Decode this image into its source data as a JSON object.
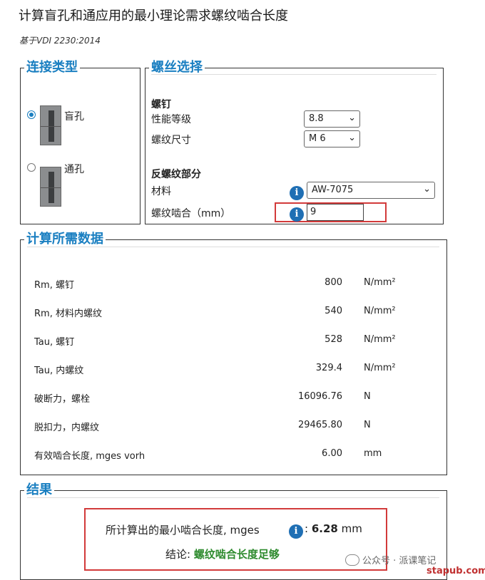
{
  "header": {
    "title": "计算盲孔和通应用的最小理论需求螺纹啮合长度",
    "subtitle": "基于VDI 2230:2014"
  },
  "connection": {
    "legend": "连接类型",
    "options": [
      {
        "label": "盲孔",
        "selected": true
      },
      {
        "label": "通孔",
        "selected": false
      }
    ]
  },
  "screw_selection": {
    "legend": "螺丝选择",
    "bolt_heading": "螺钉",
    "grade_label": "性能等级",
    "grade_value": "8.8",
    "size_label": "螺纹尺寸",
    "size_value": "M 6",
    "counter_heading": "反螺纹部分",
    "material_label": "材料",
    "material_value": "AW-7075",
    "engagement_label": "螺纹啮合（mm）",
    "engagement_value": "9"
  },
  "calc_data": {
    "legend": "计算所需数据",
    "rows": [
      {
        "label": "Rm, 螺钉",
        "value": "800",
        "unit": "N/mm²"
      },
      {
        "label": "Rm, 材料内螺纹",
        "value": "540",
        "unit": "N/mm²"
      },
      {
        "label": "Tau, 螺钉",
        "value": "528",
        "unit": "N/mm²"
      },
      {
        "label": "Tau, 内螺纹",
        "value": "329.4",
        "unit": "N/mm²"
      },
      {
        "label": "破断力，螺栓",
        "value": "16096.76",
        "unit": "N"
      },
      {
        "label": "脱扣力，内螺纹",
        "value": "29465.80",
        "unit": "N"
      },
      {
        "label": "有效啮合长度, mges vorh",
        "value": "6.00",
        "unit": "mm"
      }
    ]
  },
  "result": {
    "legend": "结果",
    "line_prefix": "所计算出的最小啮合长度, mges",
    "line_colon": ":",
    "value": "6.28",
    "unit": "mm",
    "conclusion_label": "结论:",
    "conclusion_value": "螺纹啮合长度足够"
  },
  "watermark": {
    "text": "公众号 · 派课笔记",
    "site": "stapub.com"
  },
  "colors": {
    "accent": "#1a7fc1",
    "info_icon": "#1f6fb4",
    "highlight": "#d23a3a",
    "success": "#2e8b2e"
  }
}
